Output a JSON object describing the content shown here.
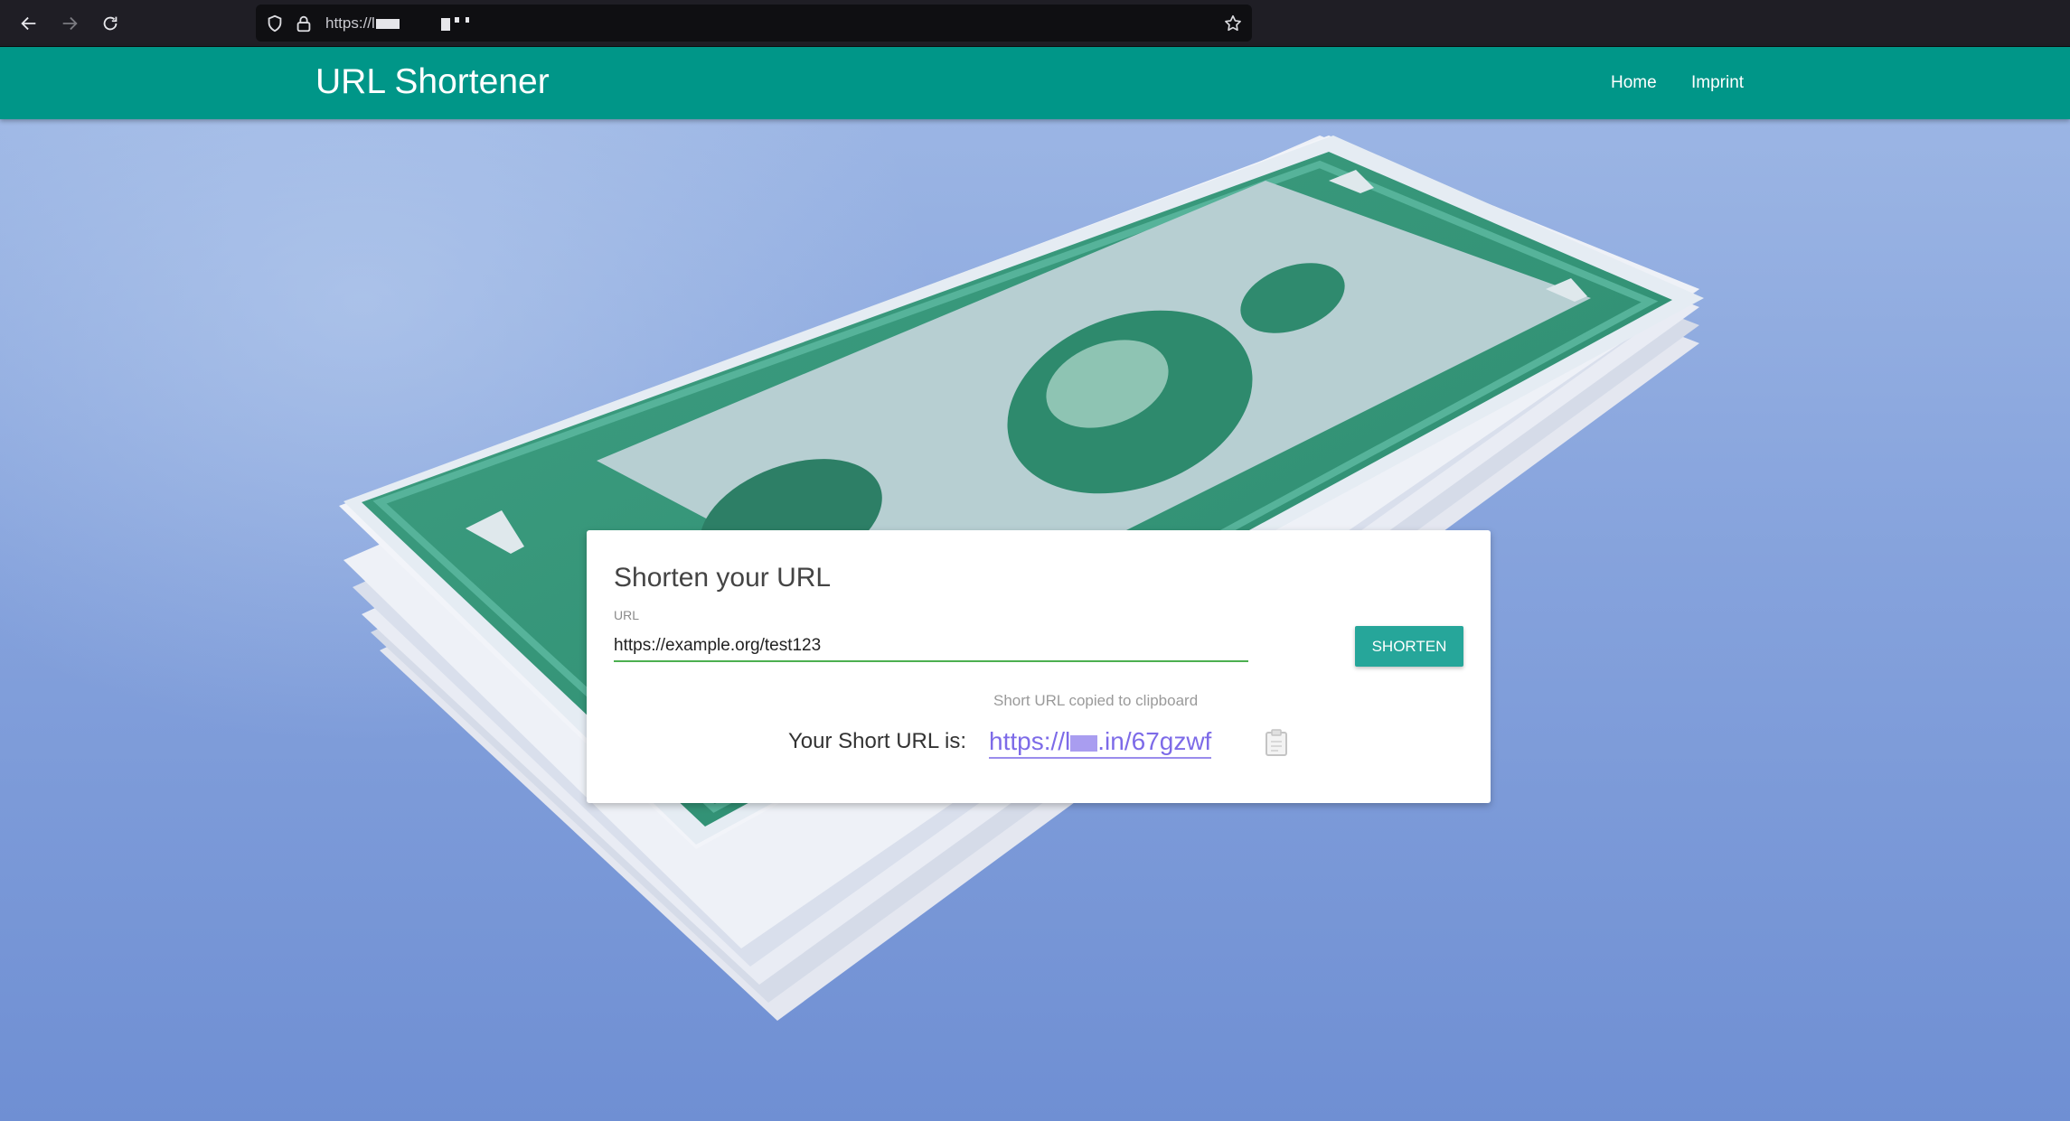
{
  "browser": {
    "url_prefix": "https://l",
    "back_icon": "arrow-left-icon",
    "forward_icon": "arrow-right-icon",
    "reload_icon": "reload-icon",
    "shield_icon": "shield-icon",
    "lock_icon": "lock-icon",
    "bookmark_icon": "star-icon"
  },
  "header": {
    "brand": "URL Shortener",
    "nav": [
      {
        "label": "Home"
      },
      {
        "label": "Imprint"
      }
    ]
  },
  "card": {
    "title": "Shorten your URL",
    "url_label": "URL",
    "url_value": "https://example.org/test123",
    "button_label": "SHORTEN",
    "copied_note": "Short URL copied to clipboard",
    "short_url_label": "Your Short URL is:",
    "short_url_prefix": "https://l",
    "short_url_suffix": ".in/67gzwf",
    "clipboard_icon": "clipboard-icon"
  },
  "colors": {
    "header": "#009688",
    "button": "#26a69a",
    "input_underline": "#4caf50",
    "link": "#7d6be8"
  }
}
